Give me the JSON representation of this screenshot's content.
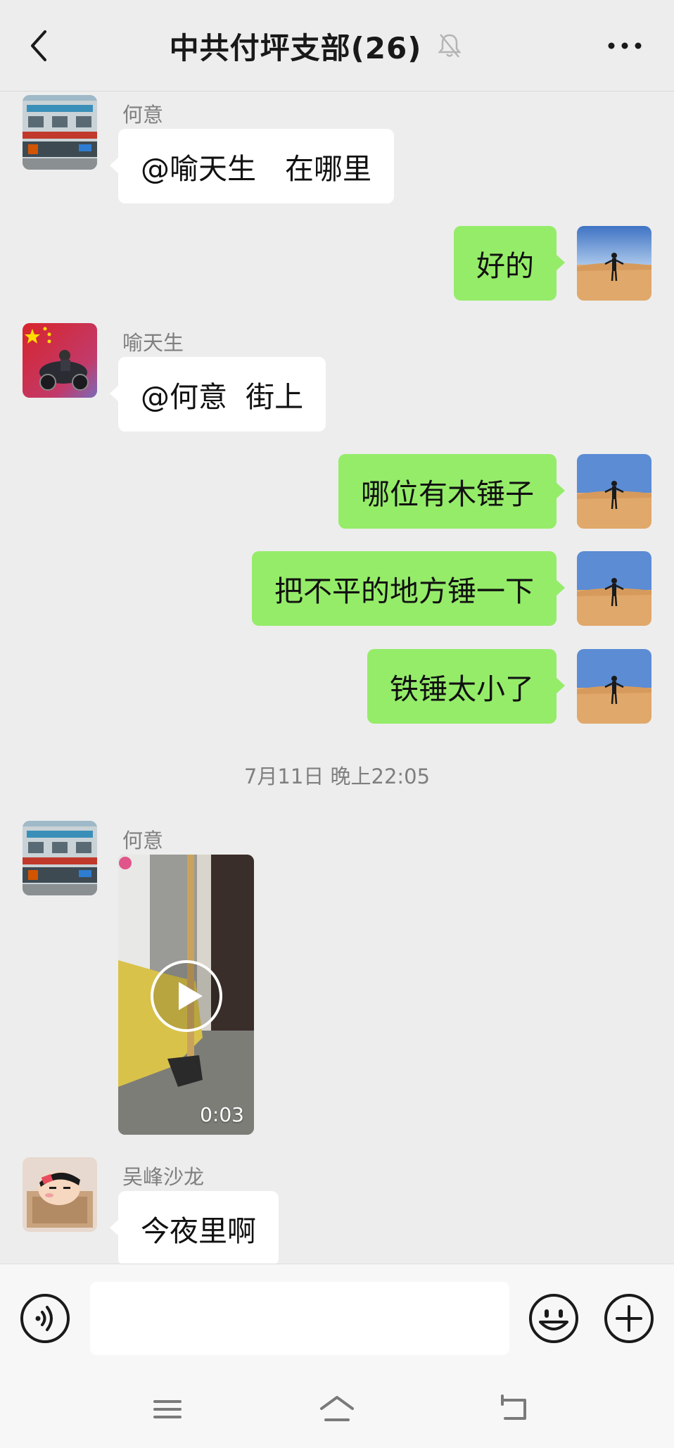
{
  "header": {
    "title": "中共付坪支部(26)",
    "back_icon": "chevron-left-icon",
    "mute_icon": "bell-muted-icon",
    "more_icon": "ellipsis-icon"
  },
  "messages": [
    {
      "side": "left",
      "sender": "何意",
      "text": "@喻天生　在哪里",
      "avatar": "building-storefront-avatar"
    },
    {
      "side": "right",
      "text": "好的",
      "avatar": "desert-person-avatar"
    },
    {
      "side": "left",
      "sender": "喻天生",
      "text": "@何意  街上",
      "avatar": "flag-motorcycle-avatar"
    },
    {
      "side": "right",
      "text": "哪位有木锤子",
      "avatar": "desert-person-avatar"
    },
    {
      "side": "right",
      "text": "把不平的地方锤一下",
      "avatar": "desert-person-avatar"
    },
    {
      "side": "right",
      "text": "铁锤太小了",
      "avatar": "desert-person-avatar"
    },
    {
      "timestamp": "7月11日 晚上22:05"
    },
    {
      "side": "left",
      "sender": "何意",
      "type": "video",
      "duration": "0:03",
      "avatar": "building-storefront-avatar"
    },
    {
      "side": "left",
      "sender": "吴峰沙龙",
      "text": "今夜里啊",
      "avatar": "cartoon-kid-avatar"
    }
  ],
  "input_bar": {
    "voice_icon": "voice-icon",
    "text_value": "",
    "emoji_icon": "smiley-icon",
    "plus_icon": "plus-circle-icon"
  },
  "system_nav": {
    "menu_icon": "menu-icon",
    "home_icon": "home-icon",
    "back_icon": "back-icon"
  },
  "colors": {
    "background": "#ededed",
    "bubble_mine": "#95ec69",
    "bubble_other": "#ffffff",
    "sender_text": "#7f7f7f"
  }
}
